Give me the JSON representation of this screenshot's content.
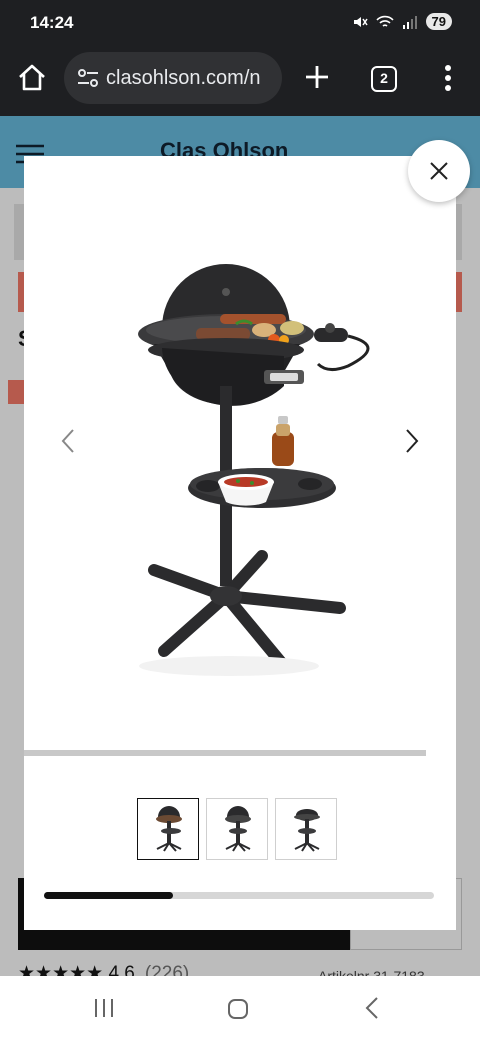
{
  "status_bar": {
    "time": "14:24",
    "battery": "79"
  },
  "browser": {
    "url": "clasohlson.com/n",
    "tab_count": "2"
  },
  "page": {
    "logo": "Clas Ohlson",
    "heading_initial": "S",
    "rating": "4.6",
    "rating_count": "(226)",
    "right_text": "Artikelnr 31-7183"
  },
  "modal": {
    "thumbnail_count": 3,
    "active_thumbnail": 1,
    "slide_progress": 0.33
  },
  "colors": {
    "header": "#4d8ba5",
    "accent_red": "#b65a4d",
    "dark": "#1e1f22"
  }
}
